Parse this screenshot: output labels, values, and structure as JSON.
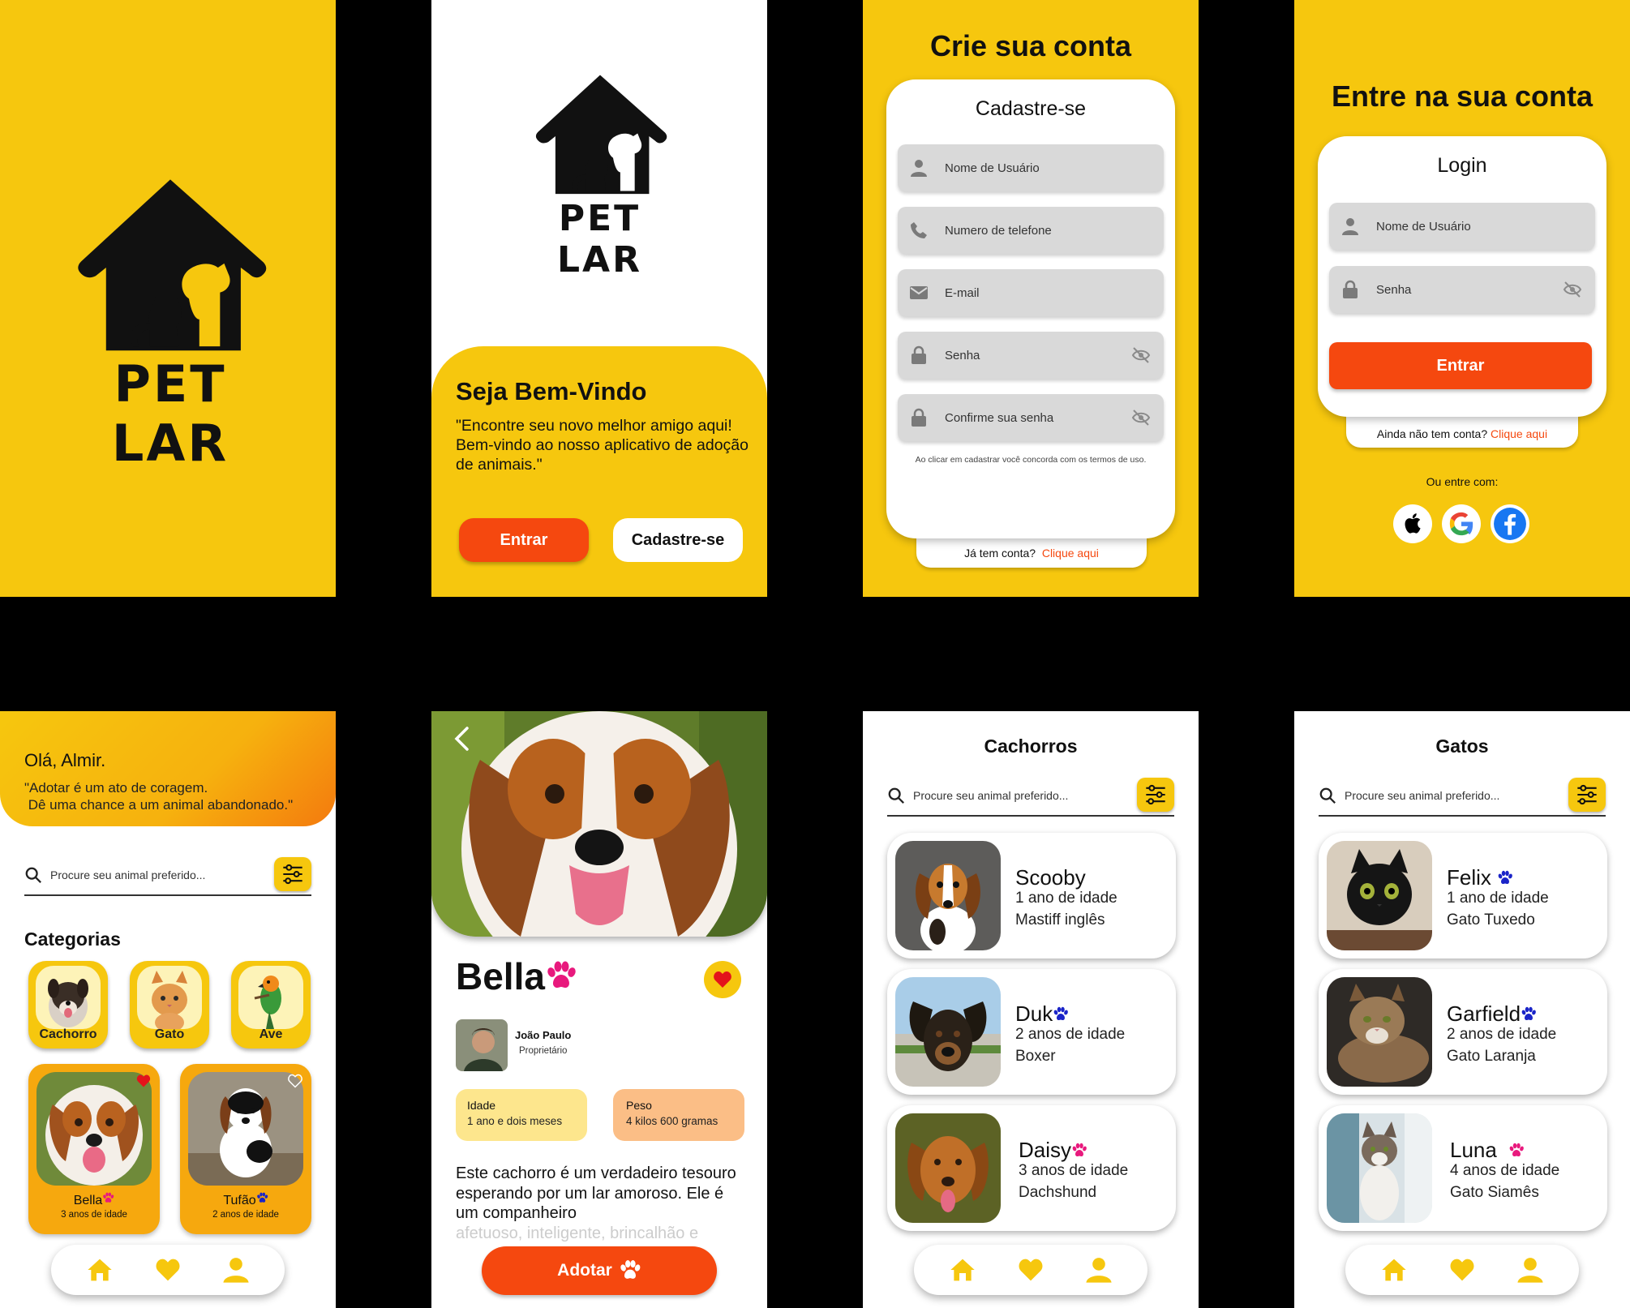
{
  "brand": "PET LAR",
  "welcome": {
    "title": "Seja Bem-Vindo",
    "text": "\"Encontre seu novo melhor amigo aqui! Bem-vindo ao nosso aplicativo de adoção de animais.\"",
    "enter_button": "Entrar",
    "signup_button": "Cadastre-se"
  },
  "signup": {
    "title": "Crie sua conta",
    "card_title": "Cadastre-se",
    "fields": [
      "Nome de Usuário",
      "Numero de telefone",
      "E-mail",
      "Senha",
      "Confirme sua senha"
    ],
    "terms": "Ao clicar em cadastrar você concorda com os termos de uso.",
    "has_account": "Já tem conta?",
    "link": "Clique aqui"
  },
  "login": {
    "title": "Entre na sua conta",
    "card_title": "Login",
    "fields": [
      "Nome de Usuário",
      "Senha"
    ],
    "button": "Entrar",
    "no_account": "Ainda não tem conta?",
    "link": "Clique aqui",
    "social_label": "Ou entre com:",
    "social": [
      "apple-icon",
      "google-icon",
      "facebook-icon"
    ]
  },
  "home": {
    "greeting": "Olá, Almir.",
    "quote": "\"Adotar é um ato de coragem.\n Dê uma chance a um animal abandonado.\"",
    "search_placeholder": "Procure seu animal preferido...",
    "categories_title": "Categorias",
    "categories": [
      "Cachorro",
      "Gato",
      "Ave"
    ],
    "favorites": [
      {
        "name": "Bella",
        "age": "3 anos de idade",
        "gender": "female",
        "liked": true
      },
      {
        "name": "Tufão",
        "age": "2 anos de idade",
        "gender": "male",
        "liked": false
      }
    ]
  },
  "detail": {
    "name": "Bella",
    "owner_name": "João Paulo",
    "owner_role": "Proprietário",
    "age_label": "Idade",
    "age_value": "1 ano e dois meses",
    "weight_label": "Peso",
    "weight_value": "4 kilos 600 gramas",
    "description": "Este cachorro é um verdadeiro tesouro esperando por um lar amoroso. Ele é um companheiro",
    "description_faded": "afetuoso, inteligente, brincalhão e",
    "adopt_button": "Adotar"
  },
  "dogs": {
    "title": "Cachorros",
    "search_placeholder": "Procure seu animal preferido...",
    "items": [
      {
        "name": "Scooby",
        "age": "1 ano de idade",
        "breed": "Mastiff inglês",
        "gender": "none"
      },
      {
        "name": "Duk",
        "age": "2 anos de idade",
        "breed": "Boxer",
        "gender": "male"
      },
      {
        "name": "Daisy",
        "age": "3 anos de idade",
        "breed": "Dachshund",
        "gender": "female"
      }
    ]
  },
  "cats": {
    "title": "Gatos",
    "search_placeholder": "Procure seu animal preferido...",
    "items": [
      {
        "name": "Felix",
        "age": "1 ano de idade",
        "breed": "Gato Tuxedo",
        "gender": "male"
      },
      {
        "name": "Garfield",
        "age": "2 anos de idade",
        "breed": "Gato Laranja",
        "gender": "male"
      },
      {
        "name": "Luna",
        "age": "4 anos de idade",
        "breed": "Gato Siamês",
        "gender": "female"
      }
    ]
  },
  "colors": {
    "yellow": "#f6c70e",
    "orange": "#f5480f",
    "pink": "#e8197d",
    "blue": "#1a24c8"
  }
}
